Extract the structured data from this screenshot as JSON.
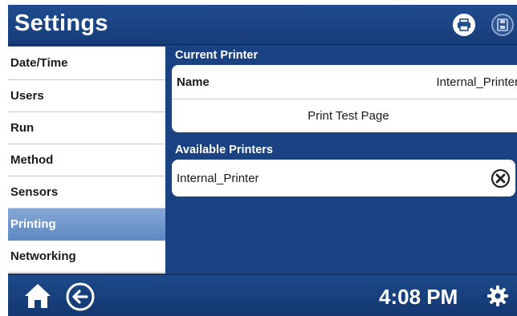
{
  "header": {
    "title": "Settings",
    "icons": [
      "printer-icon",
      "save-icon"
    ]
  },
  "sidebar": {
    "items": [
      {
        "label": "Date/Time"
      },
      {
        "label": "Users"
      },
      {
        "label": "Run"
      },
      {
        "label": "Method"
      },
      {
        "label": "Sensors"
      },
      {
        "label": "Printing",
        "active": true
      },
      {
        "label": "Networking"
      }
    ]
  },
  "main": {
    "current_printer": {
      "heading": "Current Printer",
      "name_label": "Name",
      "name_value": "Internal_Printer",
      "test_page_label": "Print Test Page"
    },
    "available_printers": {
      "heading": "Available Printers",
      "items": [
        {
          "name": "Internal_Printer",
          "icon": "remove-icon"
        }
      ]
    }
  },
  "footer": {
    "time": "4:08 PM",
    "icons": [
      "home-icon",
      "back-arrow-icon",
      "gear-icon"
    ]
  },
  "colors": {
    "background": "#1a4181",
    "header": "#1f4c8f",
    "active_item": "#6f96cc"
  }
}
